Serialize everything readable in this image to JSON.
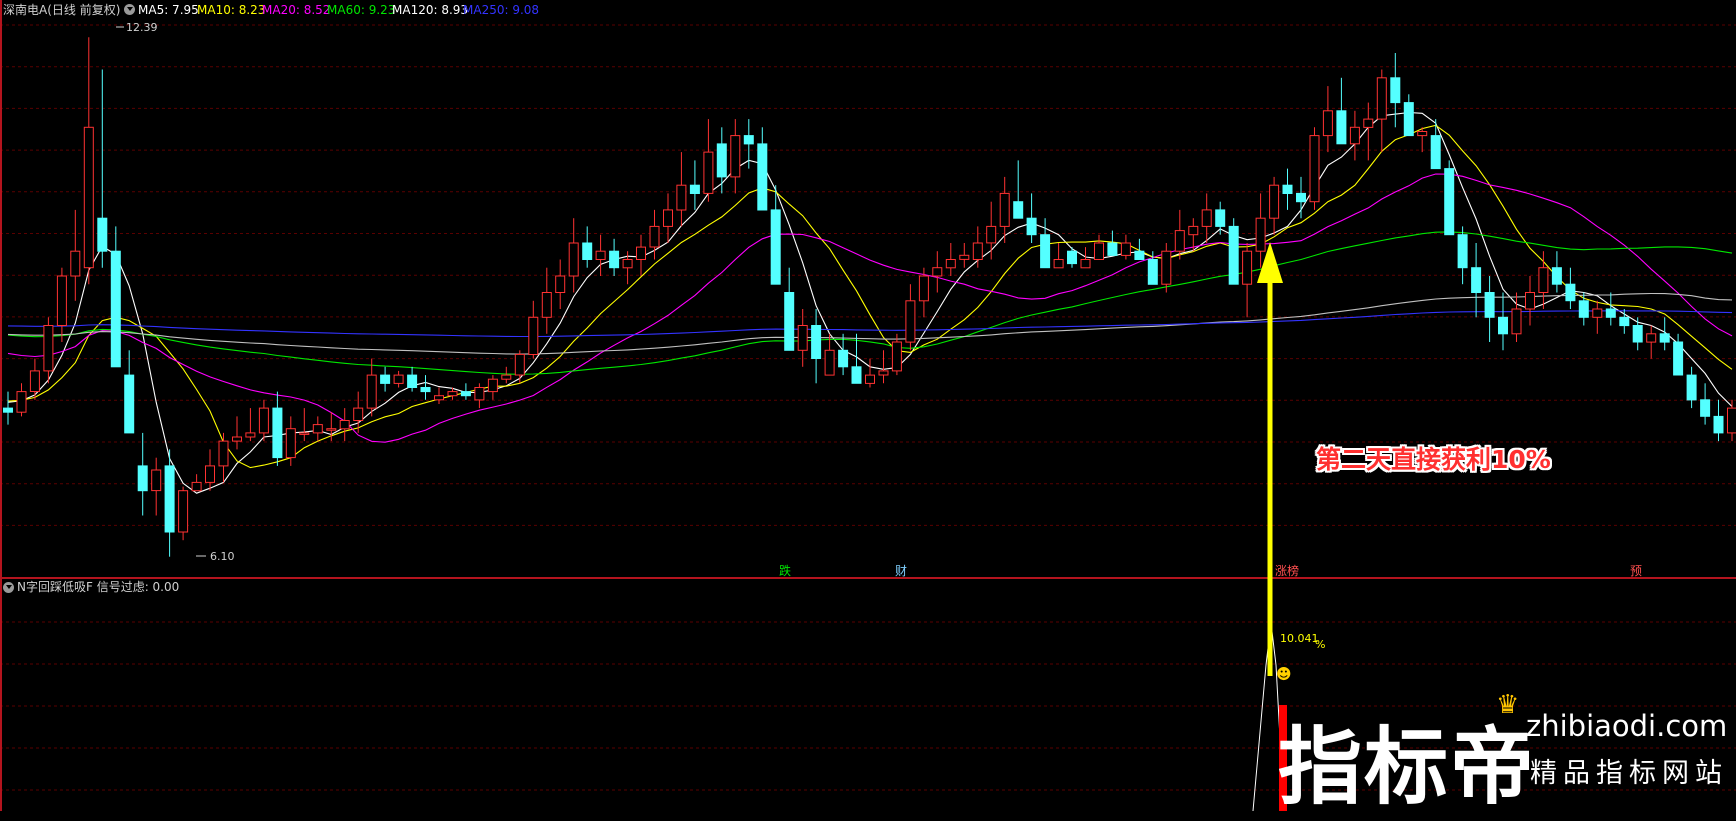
{
  "header": {
    "stock": "深南电A(日线 前复权)",
    "ma": [
      {
        "label": "MA5: 7.95",
        "color": "#ffffff"
      },
      {
        "label": "MA10: 8.23",
        "color": "#ffff00"
      },
      {
        "label": "MA20: 8.52",
        "color": "#ff00ff"
      },
      {
        "label": "MA60: 9.23",
        "color": "#00e600"
      },
      {
        "label": "MA120: 8.93",
        "color": "#ffffff"
      },
      {
        "label": "MA250: 9.08",
        "color": "#3333ff"
      }
    ]
  },
  "sub_header": "N字回踩低吸F  信号过虑: 0.00",
  "price_labels": {
    "high": "12.39",
    "low": "6.10"
  },
  "annotation": "第二天直接获利10%",
  "signal_value": "10.041",
  "signal_unit": "%",
  "markers": [
    {
      "text": "跌",
      "color": "#00e600"
    },
    {
      "text": "财",
      "color": "#7fd0ff"
    },
    {
      "text": "涨榜",
      "color": "#ff5050"
    },
    {
      "text": "预",
      "color": "#ff5050"
    }
  ],
  "watermark": {
    "brand": "指标帝",
    "domain": "zhibiaodi.com",
    "tagline": "精品指标网站"
  },
  "colors": {
    "up": "#ff3232",
    "down": "#54ffff",
    "grid": "#5a0000",
    "divider": "#b4141e",
    "arrow": "#ffff00"
  },
  "chart_data": {
    "type": "candlestick",
    "ylim": [
      6.0,
      12.6
    ],
    "ohlc": [
      [
        7.9,
        8.1,
        7.7,
        7.85
      ],
      [
        7.85,
        8.2,
        7.8,
        8.1
      ],
      [
        8.1,
        8.5,
        8.0,
        8.35
      ],
      [
        8.35,
        9.0,
        8.2,
        8.9
      ],
      [
        8.9,
        9.6,
        8.7,
        9.5
      ],
      [
        9.5,
        10.3,
        9.2,
        9.8
      ],
      [
        9.6,
        12.39,
        9.4,
        11.3
      ],
      [
        10.2,
        12.0,
        9.6,
        9.8
      ],
      [
        9.8,
        10.1,
        8.6,
        8.4
      ],
      [
        8.3,
        8.6,
        7.8,
        7.6
      ],
      [
        7.2,
        7.6,
        6.6,
        6.9
      ],
      [
        6.9,
        7.3,
        6.6,
        7.15
      ],
      [
        7.2,
        7.4,
        6.1,
        6.4
      ],
      [
        6.4,
        6.95,
        6.3,
        6.9
      ],
      [
        6.9,
        7.1,
        6.9,
        7.0
      ],
      [
        7.0,
        7.4,
        6.9,
        7.2
      ],
      [
        7.2,
        7.6,
        7.0,
        7.5
      ],
      [
        7.5,
        7.8,
        7.4,
        7.55
      ],
      [
        7.55,
        7.9,
        7.5,
        7.6
      ],
      [
        7.6,
        8.0,
        7.5,
        7.9
      ],
      [
        7.9,
        8.1,
        7.2,
        7.3
      ],
      [
        7.3,
        7.8,
        7.2,
        7.65
      ],
      [
        7.6,
        7.9,
        7.5,
        7.6
      ],
      [
        7.6,
        7.8,
        7.5,
        7.7
      ],
      [
        7.65,
        7.85,
        7.5,
        7.65
      ],
      [
        7.65,
        7.9,
        7.5,
        7.75
      ],
      [
        7.75,
        8.1,
        7.6,
        7.9
      ],
      [
        7.9,
        8.5,
        7.8,
        8.3
      ],
      [
        8.3,
        8.4,
        8.1,
        8.2
      ],
      [
        8.2,
        8.35,
        8.15,
        8.3
      ],
      [
        8.3,
        8.4,
        8.1,
        8.15
      ],
      [
        8.15,
        8.3,
        8.0,
        8.1
      ],
      [
        8.0,
        8.15,
        7.95,
        8.05
      ],
      [
        8.05,
        8.15,
        8.0,
        8.1
      ],
      [
        8.1,
        8.2,
        8.0,
        8.05
      ],
      [
        8.0,
        8.2,
        7.9,
        8.15
      ],
      [
        8.1,
        8.3,
        8.0,
        8.25
      ],
      [
        8.25,
        8.4,
        8.2,
        8.3
      ],
      [
        8.3,
        8.6,
        8.2,
        8.55
      ],
      [
        8.55,
        9.2,
        8.5,
        9.0
      ],
      [
        9.0,
        9.6,
        8.8,
        9.3
      ],
      [
        9.3,
        9.7,
        9.1,
        9.5
      ],
      [
        9.5,
        10.2,
        9.3,
        9.9
      ],
      [
        9.9,
        10.1,
        9.6,
        9.7
      ],
      [
        9.7,
        10.0,
        9.5,
        9.8
      ],
      [
        9.8,
        9.95,
        9.5,
        9.6
      ],
      [
        9.6,
        9.8,
        9.4,
        9.7
      ],
      [
        9.7,
        10.0,
        9.5,
        9.85
      ],
      [
        9.85,
        10.3,
        9.7,
        10.1
      ],
      [
        10.1,
        10.5,
        9.9,
        10.3
      ],
      [
        10.3,
        11.0,
        10.1,
        10.6
      ],
      [
        10.6,
        10.9,
        10.3,
        10.5
      ],
      [
        10.5,
        11.4,
        10.4,
        11.0
      ],
      [
        11.1,
        11.3,
        10.5,
        10.7
      ],
      [
        10.7,
        11.4,
        10.5,
        11.2
      ],
      [
        11.2,
        11.4,
        10.8,
        11.1
      ],
      [
        11.1,
        11.3,
        10.6,
        10.3
      ],
      [
        10.3,
        10.6,
        9.5,
        9.4
      ],
      [
        9.3,
        9.6,
        8.6,
        8.6
      ],
      [
        8.6,
        9.1,
        8.4,
        8.9
      ],
      [
        8.9,
        9.1,
        8.2,
        8.5
      ],
      [
        8.3,
        8.8,
        8.3,
        8.6
      ],
      [
        8.6,
        8.8,
        8.3,
        8.4
      ],
      [
        8.4,
        8.8,
        8.2,
        8.2
      ],
      [
        8.2,
        8.5,
        8.15,
        8.3
      ],
      [
        8.3,
        8.6,
        8.2,
        8.35
      ],
      [
        8.35,
        8.8,
        8.3,
        8.7
      ],
      [
        8.7,
        9.4,
        8.6,
        9.2
      ],
      [
        9.2,
        9.6,
        9.0,
        9.5
      ],
      [
        9.5,
        9.8,
        9.3,
        9.6
      ],
      [
        9.6,
        9.9,
        9.5,
        9.7
      ],
      [
        9.7,
        9.9,
        9.6,
        9.75
      ],
      [
        9.7,
        10.1,
        9.6,
        9.9
      ],
      [
        9.9,
        10.4,
        9.7,
        10.1
      ],
      [
        10.1,
        10.7,
        9.9,
        10.5
      ],
      [
        10.4,
        10.9,
        10.2,
        10.2
      ],
      [
        10.2,
        10.5,
        9.9,
        10.0
      ],
      [
        10.0,
        10.2,
        9.7,
        9.6
      ],
      [
        9.6,
        9.9,
        9.6,
        9.7
      ],
      [
        9.8,
        9.85,
        9.6,
        9.65
      ],
      [
        9.6,
        9.85,
        9.6,
        9.7
      ],
      [
        9.7,
        10.0,
        9.7,
        9.9
      ],
      [
        9.9,
        10.05,
        9.75,
        9.75
      ],
      [
        9.75,
        10.0,
        9.7,
        9.9
      ],
      [
        9.8,
        9.95,
        9.7,
        9.7
      ],
      [
        9.7,
        9.8,
        9.4,
        9.4
      ],
      [
        9.4,
        9.9,
        9.3,
        9.8
      ],
      [
        9.8,
        10.3,
        9.7,
        10.05
      ],
      [
        10.0,
        10.2,
        9.8,
        10.1
      ],
      [
        10.1,
        10.5,
        9.9,
        10.3
      ],
      [
        10.3,
        10.4,
        10.0,
        10.1
      ],
      [
        10.1,
        10.2,
        9.5,
        9.4
      ],
      [
        9.4,
        9.9,
        9.0,
        9.8
      ],
      [
        9.8,
        10.5,
        9.6,
        10.2
      ],
      [
        10.2,
        10.7,
        10.0,
        10.6
      ],
      [
        10.6,
        10.8,
        10.3,
        10.5
      ],
      [
        10.5,
        10.7,
        10.2,
        10.4
      ],
      [
        10.4,
        11.3,
        10.3,
        11.2
      ],
      [
        11.2,
        11.8,
        11.0,
        11.5
      ],
      [
        11.5,
        11.9,
        11.1,
        11.1
      ],
      [
        11.1,
        11.5,
        10.9,
        11.3
      ],
      [
        11.3,
        11.6,
        10.9,
        11.4
      ],
      [
        11.4,
        12.0,
        11.0,
        11.9
      ],
      [
        11.9,
        12.2,
        11.3,
        11.6
      ],
      [
        11.6,
        11.7,
        11.2,
        11.2
      ],
      [
        11.2,
        11.3,
        11.0,
        11.25
      ],
      [
        11.2,
        11.4,
        11.0,
        10.8
      ],
      [
        10.8,
        10.9,
        10.3,
        10.0
      ],
      [
        10.0,
        10.1,
        9.4,
        9.6
      ],
      [
        9.6,
        9.9,
        9.0,
        9.3
      ],
      [
        9.3,
        9.5,
        8.7,
        9.0
      ],
      [
        9.0,
        9.3,
        8.6,
        8.8
      ],
      [
        8.8,
        9.3,
        8.7,
        9.1
      ],
      [
        9.1,
        9.5,
        8.9,
        9.3
      ],
      [
        9.3,
        9.8,
        9.1,
        9.6
      ],
      [
        9.6,
        9.8,
        9.3,
        9.4
      ],
      [
        9.4,
        9.6,
        9.1,
        9.2
      ],
      [
        9.2,
        9.3,
        8.9,
        9.0
      ],
      [
        9.0,
        9.2,
        8.8,
        9.1
      ],
      [
        9.1,
        9.3,
        8.9,
        9.0
      ],
      [
        9.0,
        9.1,
        8.8,
        8.9
      ],
      [
        8.9,
        9.0,
        8.6,
        8.7
      ],
      [
        8.7,
        8.9,
        8.5,
        8.8
      ],
      [
        8.8,
        9.0,
        8.6,
        8.7
      ],
      [
        8.7,
        8.8,
        8.3,
        8.3
      ],
      [
        8.3,
        8.4,
        7.9,
        8.0
      ],
      [
        8.0,
        8.2,
        7.7,
        7.8
      ],
      [
        7.8,
        8.0,
        7.5,
        7.6
      ],
      [
        7.6,
        8.0,
        7.5,
        7.9
      ]
    ],
    "ma_series": [
      {
        "name": "MA5",
        "color": "#ffffff"
      },
      {
        "name": "MA10",
        "color": "#ffff00"
      },
      {
        "name": "MA20",
        "color": "#ff00ff"
      },
      {
        "name": "MA60",
        "color": "#00e600"
      },
      {
        "name": "MA120",
        "color": "#c0c0c0"
      },
      {
        "name": "MA250",
        "color": "#3333ff"
      }
    ]
  }
}
